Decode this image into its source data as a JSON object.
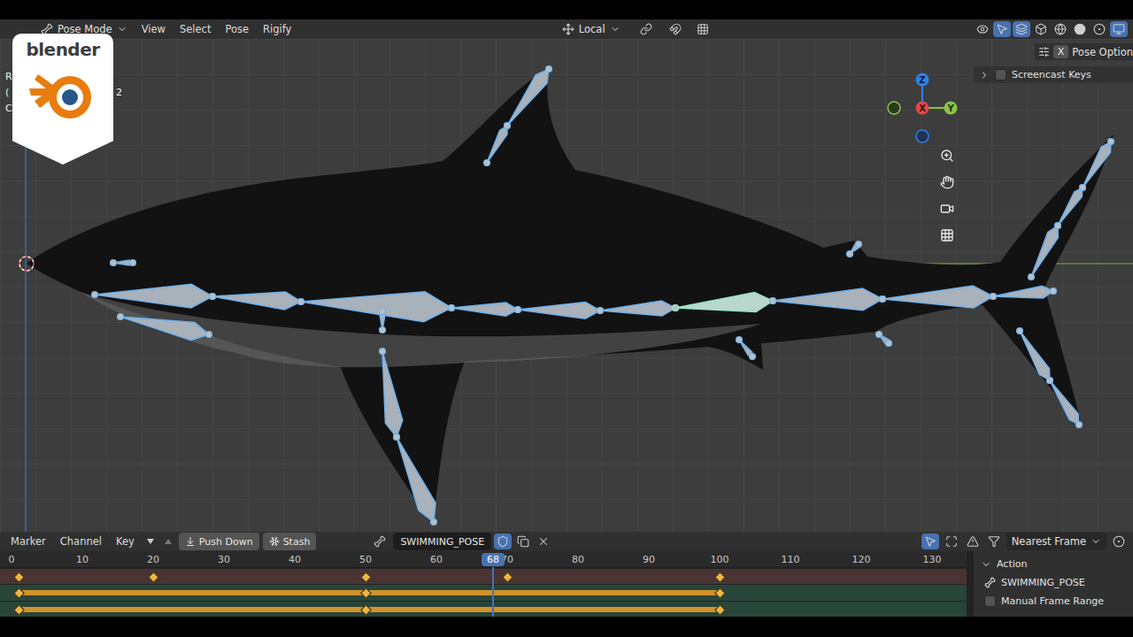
{
  "logo": {
    "text": "blender"
  },
  "header": {
    "mode": "Pose Mode",
    "menus": [
      "View",
      "Select",
      "Pose",
      "Rigify"
    ],
    "orientation": "Local"
  },
  "tool_settings": {
    "mirror": "X",
    "label": "Pose Option"
  },
  "overlay_lines": [
    [
      "R"
    ],
    [
      "(",
      "2"
    ],
    [
      "C"
    ]
  ],
  "screencast": {
    "label": "Screencast Keys",
    "enabled": false
  },
  "gizmo": {
    "axes": [
      "Z",
      "X",
      "Y"
    ]
  },
  "armature": {
    "selected": true,
    "active_bone": 6
  },
  "timeline": {
    "menus": [
      "Marker",
      "Channel",
      "Key"
    ],
    "buttons": [
      "Push Down",
      "Stash"
    ],
    "action": "SWIMMING_POSE",
    "fake_user": true,
    "snapping": "Nearest Frame",
    "ticks": [
      "0",
      "10",
      "20",
      "30",
      "40",
      "50",
      "60",
      "70",
      "80",
      "90",
      "100",
      "110",
      "120",
      "130"
    ],
    "current_frame": "68",
    "channels": [
      {
        "kind": "summary",
        "keys": [
          1,
          20,
          50,
          70,
          100
        ]
      },
      {
        "kind": "hold",
        "keys": [
          1,
          50,
          100
        ]
      },
      {
        "kind": "hold",
        "keys": [
          1,
          50,
          100
        ]
      }
    ]
  },
  "sidebar": {
    "section": "Action",
    "expanded": true,
    "action": "SWIMMING_POSE",
    "manual_frame_range": {
      "label": "Manual Frame Range",
      "checked": false
    }
  }
}
